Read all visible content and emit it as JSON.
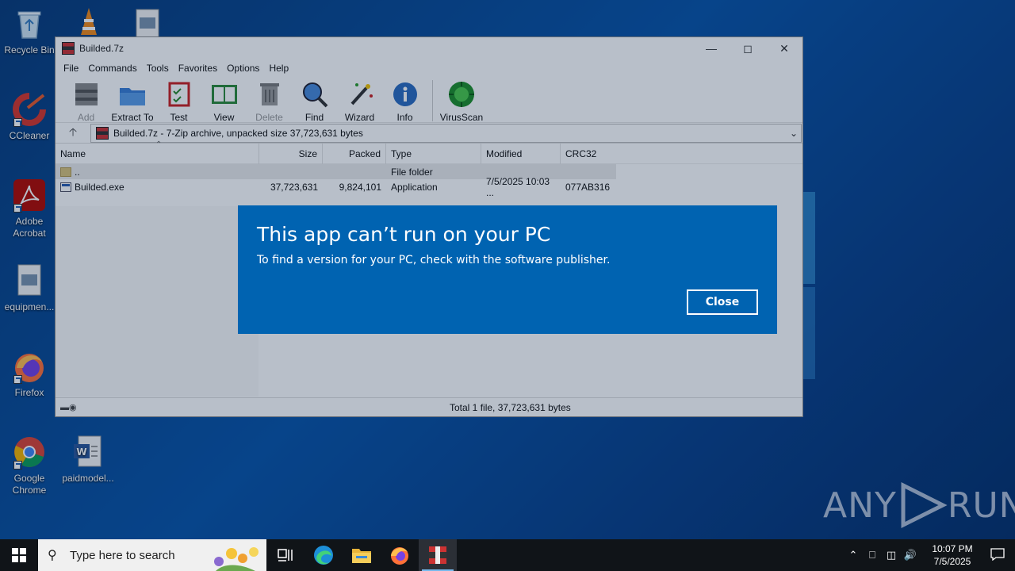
{
  "desktop": {
    "icons": [
      {
        "label": "Recycle Bin"
      },
      {
        "label": "CCleaner"
      },
      {
        "label": "Adobe Acrobat"
      },
      {
        "label": "equipmen..."
      },
      {
        "label": "Firefox"
      },
      {
        "label": "Google Chrome"
      },
      {
        "label": "paidmodel..."
      }
    ]
  },
  "window": {
    "title": "Builded.7z",
    "menu": [
      "File",
      "Commands",
      "Tools",
      "Favorites",
      "Options",
      "Help"
    ],
    "toolbar": [
      {
        "label": "Add",
        "disabled": true
      },
      {
        "label": "Extract To"
      },
      {
        "label": "Test"
      },
      {
        "label": "View"
      },
      {
        "label": "Delete",
        "disabled": true
      },
      {
        "label": "Find"
      },
      {
        "label": "Wizard"
      },
      {
        "label": "Info"
      },
      {
        "label": "VirusScan"
      }
    ],
    "address": "Builded.7z - 7-Zip archive, unpacked size 37,723,631 bytes",
    "columns": {
      "name": "Name",
      "size": "Size",
      "packed": "Packed",
      "type": "Type",
      "modified": "Modified",
      "crc": "CRC32"
    },
    "rows": [
      {
        "name": "..",
        "size": "",
        "packed": "",
        "type": "File folder",
        "modified": "",
        "crc": ""
      },
      {
        "name": "Builded.exe",
        "size": "37,723,631",
        "packed": "9,824,101",
        "type": "Application",
        "modified": "7/5/2025 10:03 ...",
        "crc": "077AB316"
      }
    ],
    "status": "Total 1 file, 37,723,631 bytes"
  },
  "dialog": {
    "title": "This app can’t run on your PC",
    "message": "To find a version for your PC, check with the software publisher.",
    "close_label": "Close"
  },
  "taskbar": {
    "search_placeholder": "Type here to search",
    "time": "10:07 PM",
    "date": "7/5/2025"
  },
  "watermark": {
    "text_left": "ANY",
    "text_right": "RUN"
  },
  "colors": {
    "dialog_bg": "#0063b1",
    "taskbar_bg": "#101418",
    "accent": "#76b9ed"
  }
}
